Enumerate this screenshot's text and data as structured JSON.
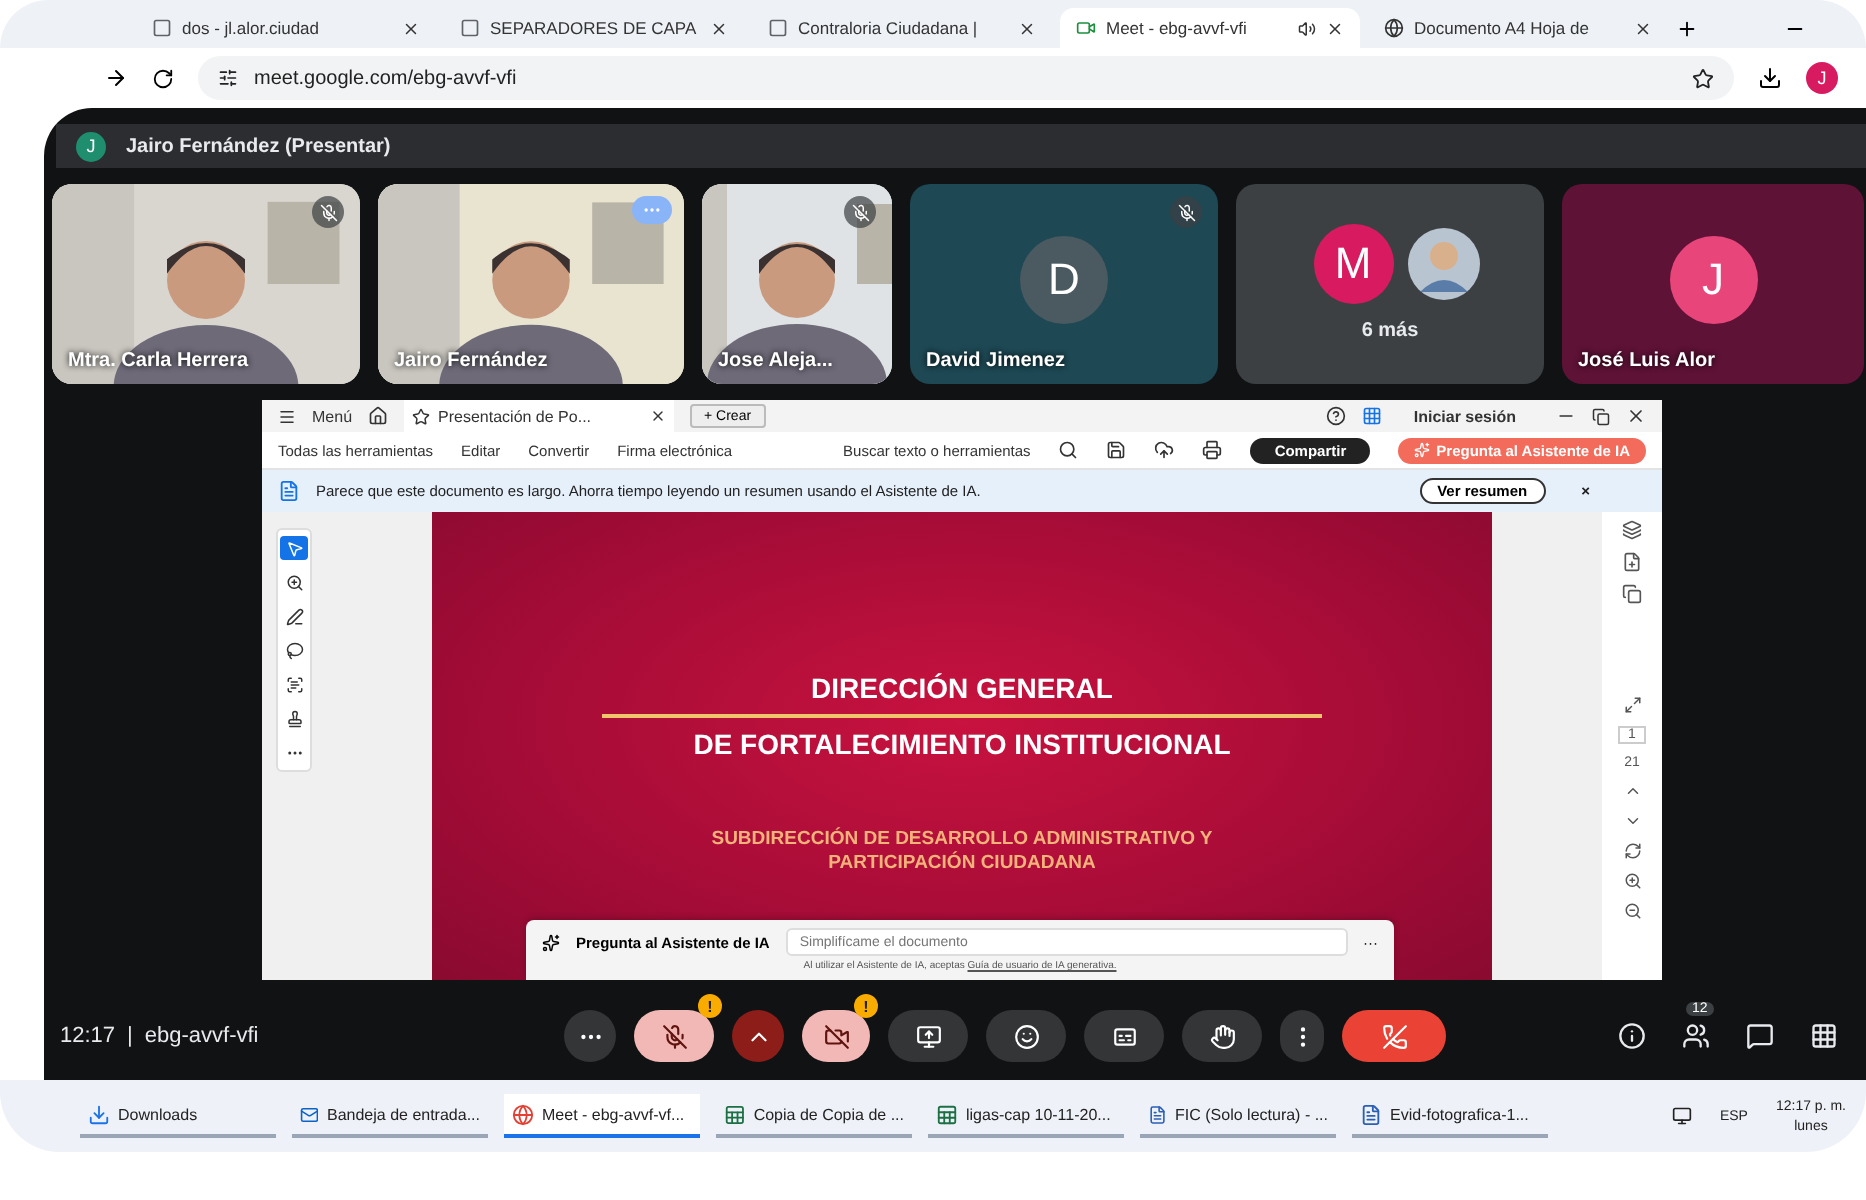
{
  "browser": {
    "tabs": [
      {
        "title": "dos - jl.alor.ciudad",
        "selected": false
      },
      {
        "title": "SEPARADORES DE CAPA",
        "selected": false
      },
      {
        "title": "Contraloria Ciudadana | ",
        "selected": false
      },
      {
        "title": "Meet - ebg-avvf-vfi",
        "selected": true
      },
      {
        "title": "Documento A4 Hoja de ",
        "selected": false
      }
    ],
    "url": "meet.google.com/ebg-avvf-vfi",
    "profile": "J"
  },
  "meet": {
    "presenter": {
      "initial": "J",
      "label": "Jairo Fernández (Presentar)"
    },
    "tiles": [
      {
        "kind": "video",
        "name": "Mtra. Carla Herrera",
        "muted": true
      },
      {
        "kind": "video",
        "name": "Jairo Fernández",
        "muted": false
      },
      {
        "kind": "video",
        "name": "Jose Aleja...",
        "muted": true
      },
      {
        "kind": "avatar",
        "name": "David Jimenez",
        "initial": "D",
        "muted": true,
        "color": "#4a5a60"
      },
      {
        "kind": "more",
        "initial": "M",
        "count": "6 más",
        "muted": false,
        "color": "#d81b60"
      },
      {
        "kind": "avatar",
        "name": "José Luis Alor",
        "initial": "J",
        "muted": false,
        "color": "#e8457a"
      }
    ],
    "time": "12:17",
    "separator": "|",
    "code": "ebg-avvf-vfi",
    "controls": [
      {
        "kind": "more"
      },
      {
        "kind": "mic",
        "on": false,
        "warning": "!"
      },
      {
        "kind": "chevron"
      },
      {
        "kind": "camera",
        "on": false,
        "warning": "!"
      },
      {
        "kind": "present"
      },
      {
        "kind": "emoji"
      },
      {
        "kind": "captions"
      },
      {
        "kind": "hand"
      },
      {
        "kind": "dots"
      },
      {
        "kind": "hangup"
      }
    ],
    "people_count": "12"
  },
  "document": {
    "menu": "Menú",
    "tab": "Presentación de Po...",
    "new": "+ Crear",
    "signin": "Iniciar sesión",
    "tools": [
      "Todas las herramientas",
      "Editar",
      "Convertir",
      "Firma electrónica"
    ],
    "search": "Buscar texto o herramientas",
    "share": "Compartir",
    "ask": "Pregunta al Asistente de IA",
    "banner": "Parece que este documento es largo. Ahorra tiempo leyendo un resumen usando el Asistente de IA.",
    "banner_button": "Ver resumen",
    "banner_close": "×",
    "slide": {
      "title_1": "DIRECCIÓN GENERAL",
      "title_2": "DE FORTALECIMIENTO INSTITUCIONAL",
      "subtitle": "SUBDIRECCIÓN DE DESARROLLO ADMINISTRATIVO Y PARTICIPACIÓN CIUDADANA"
    },
    "page": "1",
    "pages": "21",
    "assistant": {
      "label": "Pregunta al Asistente de IA",
      "placeholder": "Simplifícame el documento",
      "more": "···",
      "terms": "Al utilizar el Asistente de IA, aceptas",
      "terms_link": "Guía de usuario de IA generativa."
    }
  },
  "taskbar": {
    "items": [
      {
        "label": "Downloads",
        "selected": false
      },
      {
        "label": "Bandeja de entrada...",
        "selected": false
      },
      {
        "label": "Meet - ebg-avvf-vf...",
        "selected": true
      },
      {
        "label": "Copia de Copia de ...",
        "selected": false
      },
      {
        "label": "ligas-cap 10-11-20...",
        "selected": false
      },
      {
        "label": "FIC (Solo lectura) - ...",
        "selected": false
      },
      {
        "label": "Evid-fotografica-1...",
        "selected": false
      }
    ],
    "language": "ESP",
    "clock": "12:17 p. m.",
    "day": "lunes"
  }
}
